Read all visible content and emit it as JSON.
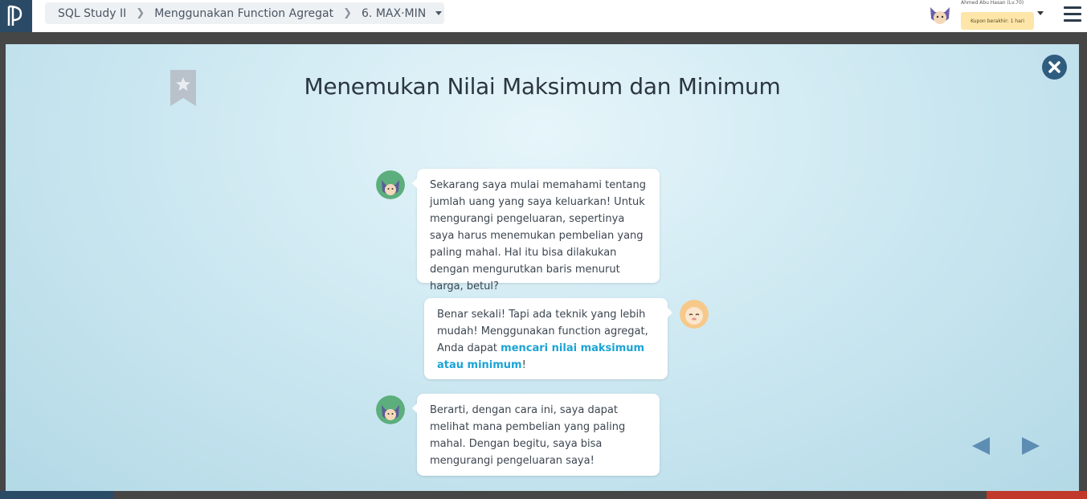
{
  "breadcrumb": {
    "course": "SQL Study II",
    "chapter": "Menggunakan Function Agregat",
    "lesson": "6. MAX·MIN"
  },
  "user": {
    "name": "Ahmed Abu Hasan (Lv.70)",
    "coupon": "Kupon berakhir: 1 hari"
  },
  "modal": {
    "title": "Menemukan Nilai Maksimum dan Minimum"
  },
  "dialog": [
    {
      "speaker": "student",
      "text": "Sekarang saya mulai memahami tentang jumlah uang yang saya keluarkan! Untuk mengurangi pengeluaran, sepertinya saya harus menemukan pembelian yang paling mahal. Hal itu bisa dilakukan dengan mengurutkan baris menurut harga, betul?"
    },
    {
      "speaker": "teacher",
      "text_before": "Benar sekali! Tapi ada teknik yang lebih mudah! Menggunakan function agregat, Anda dapat ",
      "highlight": "mencari nilai maksimum atau minimum",
      "text_after": "!"
    },
    {
      "speaker": "student",
      "text": "Berarti, dengan cara ini, saya dapat melihat mana pembelian yang paling mahal. Dengan begitu, saya bisa mengurangi pengeluaran saya!"
    }
  ],
  "colors": {
    "accent": "#1ba3d6",
    "nav_arrow": "#5e8db3",
    "close_button": "#2f5d80",
    "logo_bg": "#2b4a66"
  },
  "icons": {
    "logo": "progate-logo-icon",
    "bookmark": "bookmark-star-icon",
    "close": "close-icon",
    "prev": "arrow-left-icon",
    "next": "arrow-right-icon",
    "menu": "hamburger-menu-icon"
  }
}
